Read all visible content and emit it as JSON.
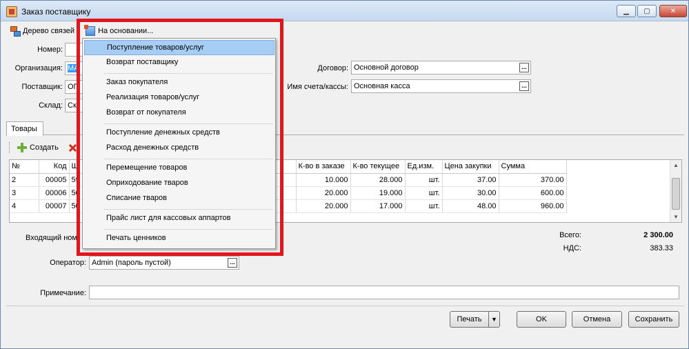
{
  "window": {
    "title": "Заказ поставщику"
  },
  "toolbar": {
    "tree_label": "Дерево связей",
    "based_on_label": "На основании..."
  },
  "form": {
    "number_label": "Номер:",
    "org_label": "Организация:",
    "org_value": "МА",
    "supplier_label": "Поставщик:",
    "supplier_value": "ОП",
    "warehouse_label": "Склад:",
    "warehouse_value": "Ск",
    "contract_label": "Договор:",
    "contract_value": "Основной договор",
    "account_label": "Имя счета/кассы:",
    "account_value": "Основная касса",
    "dots": "..."
  },
  "tabs": {
    "goods": "Товары"
  },
  "grid_toolbar": {
    "create_label": "Создать"
  },
  "table": {
    "headers": [
      "№",
      "Код",
      "Ш",
      "К-во в заказе",
      "К-во текущее",
      "Ед.изм.",
      "Цена закупки",
      "Сумма"
    ],
    "rows": [
      [
        "2",
        "00005",
        "59",
        "10.000",
        "28.000",
        "шт.",
        "37.00",
        "370.00"
      ],
      [
        "3",
        "00006",
        "50",
        "20.000",
        "19.000",
        "шт.",
        "30.00",
        "600.00"
      ],
      [
        "4",
        "00007",
        "50",
        "20.000",
        "17.000",
        "шт.",
        "48.00",
        "960.00"
      ]
    ]
  },
  "footer": {
    "incoming_label": "Входящий ном",
    "total_label": "Всего:",
    "total_value": "2 300.00",
    "vat_label": "НДС:",
    "vat_value": "383.33",
    "operator_label": "Оператор:",
    "operator_value": "Admin (пароль пустой)",
    "note_label": "Примечание:",
    "note_value": ""
  },
  "buttons": {
    "print": "Печать",
    "ok": "OK",
    "cancel": "Отмена",
    "save": "Сохранить"
  },
  "menu": {
    "items": [
      "Поступление товаров/услуг",
      "Возврат поставщику",
      "Заказ покупателя",
      "Реализация товаров/услуг",
      "Возврат от покупателя",
      "Поступление денежных средств",
      "Расход денежных средств",
      "Перемещение товаров",
      "Оприходование тваров",
      "Списание тваров",
      "Прайс лист для кассовых аппартов",
      "Печать ценников"
    ]
  },
  "colors": {
    "highlight_border": "#e1151c",
    "menu_hover": "#a6cdf3",
    "selection": "#3399ff"
  }
}
